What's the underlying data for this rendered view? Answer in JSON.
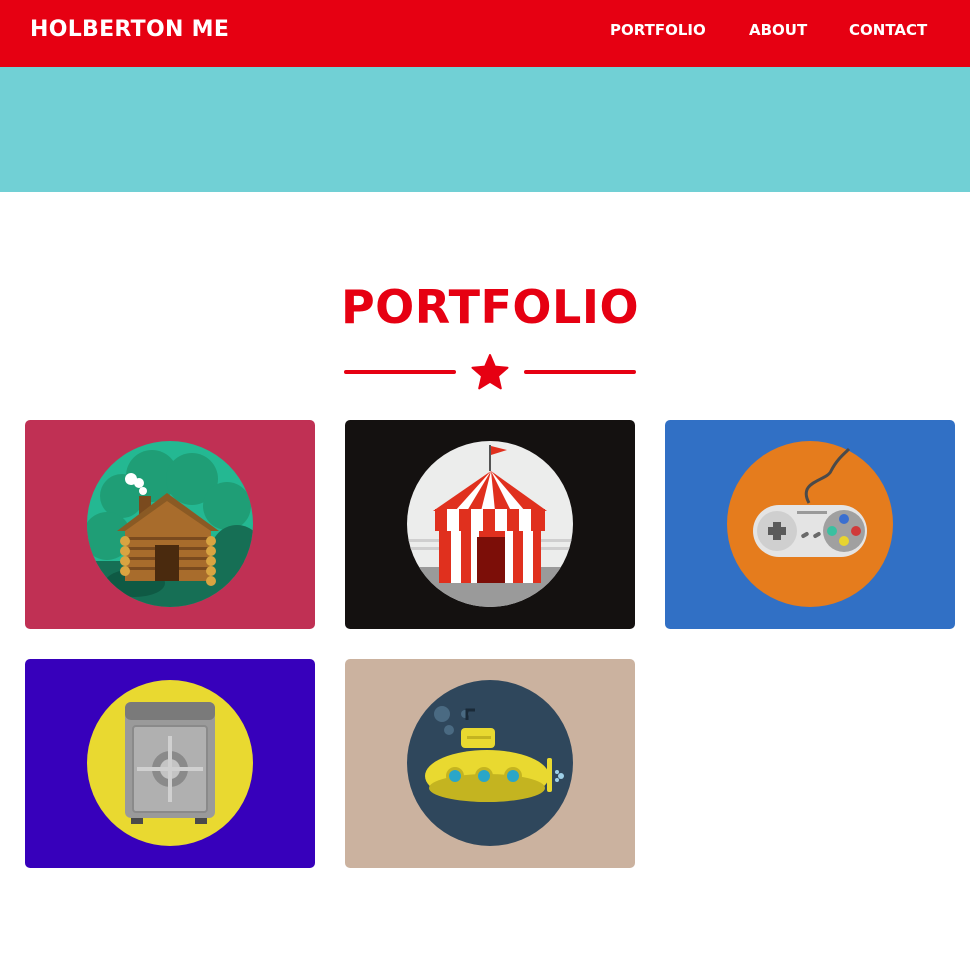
{
  "navbar": {
    "brand": "HOLBERTON ME",
    "links": [
      "PORTFOLIO",
      "ABOUT",
      "CONTACT"
    ],
    "background": "#e60012"
  },
  "hero": {
    "background": "#71d0d5"
  },
  "portfolio": {
    "title": "PORTFOLIO",
    "divider_icon": "star-icon",
    "items": [
      {
        "icon": "log-cabin-icon",
        "background": "#c03054",
        "circle": "#24b892"
      },
      {
        "icon": "circus-tent-icon",
        "background": "#141110",
        "circle": "#ecedec"
      },
      {
        "icon": "game-controller-icon",
        "background": "#3170c5",
        "circle": "#e57c1d"
      },
      {
        "icon": "safe-icon",
        "background": "#3700bb",
        "circle": "#e9d930"
      },
      {
        "icon": "submarine-icon",
        "background": "#cbb29f",
        "circle": "#2f475c"
      }
    ]
  }
}
